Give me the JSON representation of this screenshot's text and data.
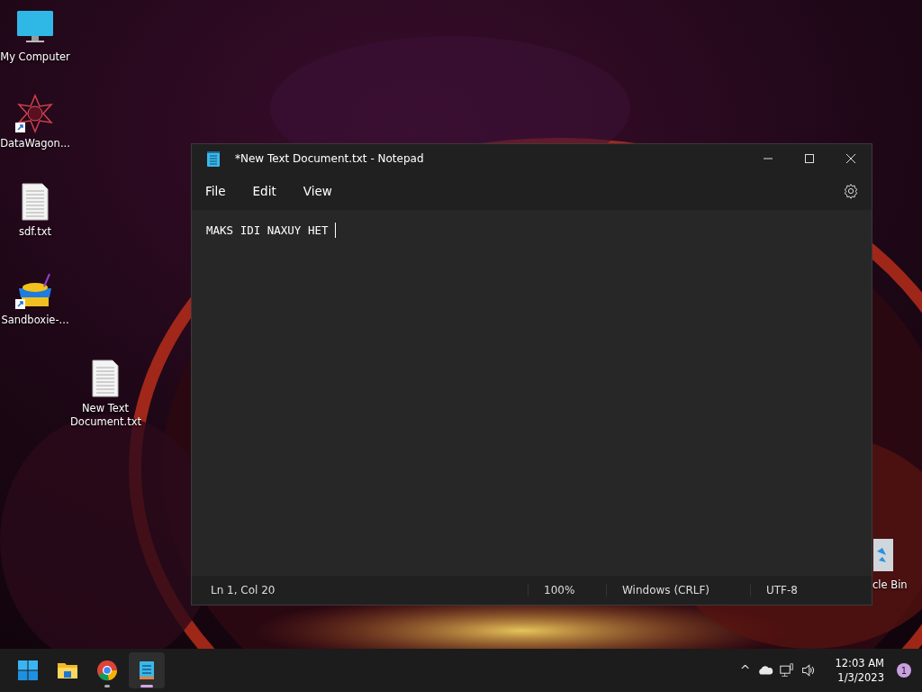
{
  "desktop_icons": [
    {
      "kind": "monitor",
      "label": "My Computer",
      "shortcut": false
    },
    {
      "kind": "star",
      "label": "DataWagon...",
      "shortcut": true
    },
    {
      "kind": "file",
      "label": "sdf.txt",
      "shortcut": false
    },
    {
      "kind": "sandbox",
      "label": "Sandboxie-...",
      "shortcut": true
    },
    {
      "kind": "file",
      "label": "New Text Document.txt",
      "shortcut": false
    }
  ],
  "recycle_bin": {
    "label": "cle Bin"
  },
  "window": {
    "title": "*New Text Document.txt - Notepad",
    "menu": [
      "File",
      "Edit",
      "View"
    ],
    "content": "MAKS IDI NAXUY HET ",
    "status_bar": [
      "Ln 1, Col 20",
      "100%",
      "Windows (CRLF)",
      "UTF-8"
    ]
  },
  "taskbar": {
    "items": [
      {
        "kind": "start",
        "running": false,
        "selected": false
      },
      {
        "kind": "folder",
        "running": false,
        "selected": false
      },
      {
        "kind": "browser",
        "running": true,
        "selected": false
      },
      {
        "kind": "notepad",
        "running": true,
        "selected": true
      }
    ],
    "tray": {
      "chevron": "^",
      "time": "12:03 AM",
      "date": "1/3/2023",
      "notifications": "1"
    }
  }
}
